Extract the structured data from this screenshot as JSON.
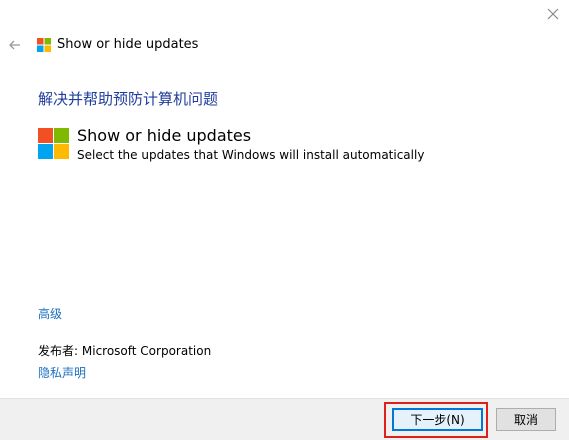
{
  "window": {
    "title": "Show or hide updates"
  },
  "main": {
    "heading": "解决并帮助预防计算机问题",
    "product_name": "Show or hide updates",
    "product_description": "Select the updates that Windows will install automatically",
    "advanced_link": "高级",
    "publisher_label": "发布者:",
    "publisher_value": "Microsoft Corporation",
    "privacy_link": "隐私声明"
  },
  "footer": {
    "next_button": "下一步(N)",
    "cancel_button": "取消"
  },
  "colors": {
    "heading": "#1f3c9e",
    "link": "#1a6fbf",
    "logo_red": "#f25022",
    "logo_green": "#7fba00",
    "logo_blue": "#00a4ef",
    "logo_yellow": "#ffb900",
    "highlight": "#e0201b",
    "primary_border": "#0078d7"
  },
  "icons": {
    "close": "close-icon",
    "back": "back-arrow-icon",
    "logo": "windows-logo-icon"
  }
}
